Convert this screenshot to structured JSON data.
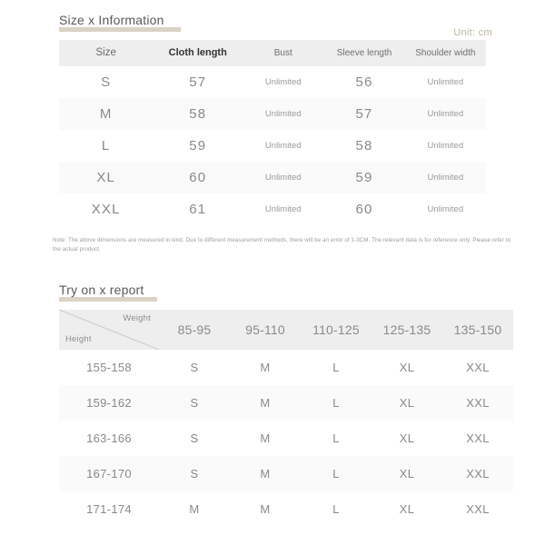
{
  "sections": {
    "size_info": {
      "title": "Size x Information",
      "unit": "Unit: cm",
      "columns": [
        "Size",
        "Cloth length",
        "Bust",
        "Sleeve length",
        "Shoulder width"
      ],
      "rows": [
        {
          "size": "S",
          "cloth_length": "57",
          "bust": "Unlimited",
          "sleeve_length": "56",
          "shoulder_width": "Unlimited"
        },
        {
          "size": "M",
          "cloth_length": "58",
          "bust": "Unlimited",
          "sleeve_length": "57",
          "shoulder_width": "Unlimited"
        },
        {
          "size": "L",
          "cloth_length": "59",
          "bust": "Unlimited",
          "sleeve_length": "58",
          "shoulder_width": "Unlimited"
        },
        {
          "size": "XL",
          "cloth_length": "60",
          "bust": "Unlimited",
          "sleeve_length": "59",
          "shoulder_width": "Unlimited"
        },
        {
          "size": "XXL",
          "cloth_length": "61",
          "bust": "Unlimited",
          "sleeve_length": "60",
          "shoulder_width": "Unlimited"
        }
      ],
      "note": "Note: The above dimensions are measured in kind. Due to different measurement methods, there will be an error of 1-3CM. The relevant data is for reference only. Please refer to the actual product."
    },
    "try_on_report": {
      "title": "Try on x report",
      "corner": {
        "weight_label": "Weight",
        "height_label": "Height"
      },
      "weight_columns": [
        "85-95",
        "95-110",
        "110-125",
        "125-135",
        "135-150"
      ],
      "rows": [
        {
          "height": "155-158",
          "sizes": [
            "S",
            "M",
            "L",
            "XL",
            "XXL"
          ]
        },
        {
          "height": "159-162",
          "sizes": [
            "S",
            "M",
            "L",
            "XL",
            "XXL"
          ]
        },
        {
          "height": "163-166",
          "sizes": [
            "S",
            "M",
            "L",
            "XL",
            "XXL"
          ]
        },
        {
          "height": "167-170",
          "sizes": [
            "S",
            "M",
            "L",
            "XL",
            "XXL"
          ]
        },
        {
          "height": "171-174",
          "sizes": [
            "M",
            "M",
            "L",
            "XL",
            "XXL"
          ]
        }
      ]
    }
  },
  "colors": {
    "title_underline": "#d9d0c1",
    "unit_text": "#bdb49f",
    "header_bg": "#efeeee",
    "stripe_bg": "#fafafa",
    "body_text": "#8a8a8a"
  }
}
